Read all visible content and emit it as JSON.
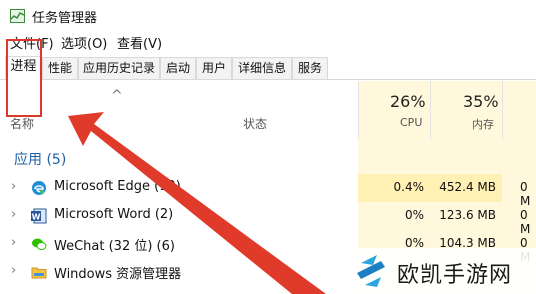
{
  "window": {
    "title": "任务管理器"
  },
  "menu": [
    "文件(F)",
    "选项(O)",
    "查看(V)"
  ],
  "tabs": [
    "进程",
    "性能",
    "应用历史记录",
    "启动",
    "用户",
    "详细信息",
    "服务"
  ],
  "columns": {
    "name": "名称",
    "status": "状态",
    "cpu_percent": "26%",
    "cpu_label": "CPU",
    "mem_percent": "35%",
    "mem_label": "内存"
  },
  "group": {
    "label": "应用 (5)"
  },
  "processes": [
    {
      "name": "Microsoft Edge (12)",
      "cpu": "0.4%",
      "memory": "452.4 MB",
      "extra": "0 M",
      "icon": "edge-icon"
    },
    {
      "name": "Microsoft Word (2)",
      "cpu": "0%",
      "memory": "123.6 MB",
      "extra": "0 M",
      "icon": "word-icon"
    },
    {
      "name": "WeChat (32 位) (6)",
      "cpu": "0%",
      "memory": "104.3 MB",
      "extra": "0 M",
      "icon": "wechat-icon"
    },
    {
      "name": "Windows 资源管理器",
      "cpu": "",
      "memory": "",
      "extra": "",
      "icon": "explorer-icon"
    }
  ],
  "watermark": {
    "text": "欧凯手游网"
  },
  "colors": {
    "highlight": "#d93a2b",
    "usage_bg": "#fff8dc",
    "group_text": "#1e5fa8"
  }
}
